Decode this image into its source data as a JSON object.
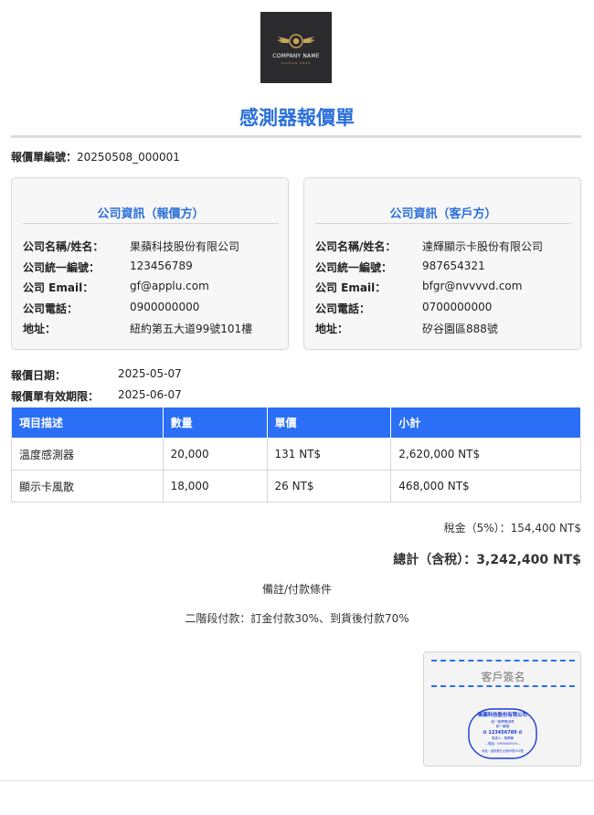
{
  "logo": {
    "company_name": "COMPANY NAME",
    "slogan": "SLOGAN HERE"
  },
  "title": "感測器報價單",
  "quote_no": {
    "label": "報價單編號：",
    "value": "20250508_000001"
  },
  "vendor": {
    "heading": "公司資訊（報價方）",
    "rows": [
      {
        "k": "公司名稱/姓名：",
        "v": "果蘋科技股份有限公司"
      },
      {
        "k": "公司統一編號：",
        "v": "123456789"
      },
      {
        "k": "公司 Email：",
        "v": "gf@applu.com"
      },
      {
        "k": "公司電話：",
        "v": "0900000000"
      },
      {
        "k": "地址：",
        "v": "紐約第五大道99號101樓"
      }
    ]
  },
  "client": {
    "heading": "公司資訊（客戶方）",
    "rows": [
      {
        "k": "公司名稱/姓名：",
        "v": "達輝顯示卡股份有限公司"
      },
      {
        "k": "公司統一編號：",
        "v": "987654321"
      },
      {
        "k": "公司 Email：",
        "v": "bfgr@nvvvvd.com"
      },
      {
        "k": "公司電話：",
        "v": "0700000000"
      },
      {
        "k": "地址：",
        "v": "矽谷園區888號"
      }
    ]
  },
  "dates": {
    "quote_date": {
      "label": "報價日期：",
      "value": "2025-05-07"
    },
    "valid_until": {
      "label": "報價單有效期限：",
      "value": "2025-06-07"
    }
  },
  "table": {
    "headers": [
      "項目描述",
      "數量",
      "單價",
      "小計"
    ],
    "rows": [
      [
        "溫度感測器",
        "20,000",
        "131 NT$",
        "2,620,000 NT$"
      ],
      [
        "顯示卡風散",
        "18,000",
        "26 NT$",
        "468,000 NT$"
      ]
    ]
  },
  "tax": "稅金（5%）：154,400 NT$",
  "total": "總計（含稅）：3,242,400 NT$",
  "remarks": {
    "title": "備註/付款條件",
    "body": "二階段付款：訂金付款30%、到貨後付款70%"
  },
  "signature": {
    "label": "客戶簽名",
    "stamp_lines": [
      "果蘋科技股份有限公司",
      "統一發票專用章",
      "統一編號",
      "123456789",
      "負責人：果蘋華",
      "電話：0900000000",
      "地址：紐約第五大道99號101樓"
    ]
  },
  "colors": {
    "accent": "#2a6fdb",
    "table_header": "#2a6ff5"
  }
}
